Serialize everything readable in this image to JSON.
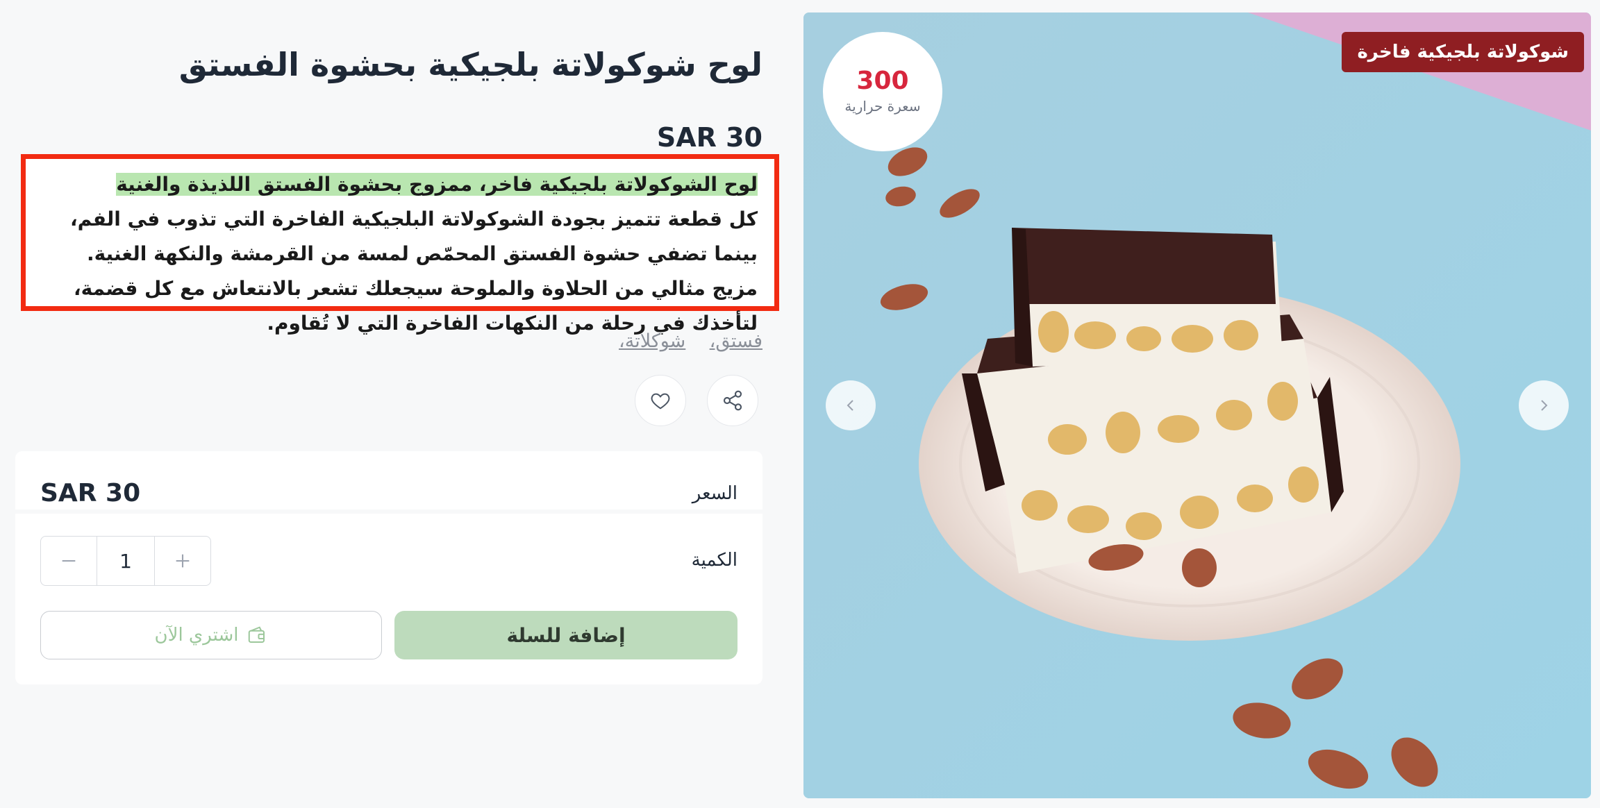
{
  "product": {
    "title": "لوح شوكولاتة بلجيكية بحشوة الفستق",
    "price": "SAR 30",
    "description_highlight": "لوح الشوكولاتة بلجيكية فاخر، ممزوج بحشوة الفستق اللذيذة والغنية",
    "description_body": "كل قطعة تتميز بجودة الشوكولاتة البلجيكية الفاخرة التي تذوب في الفم، بينما تضفي حشوة الفستق المحمّص لمسة من القرمشة والنكهة الغنية. مزيج مثالي من الحلاوة والملوحة سيجعلك تشعر بالانتعاش مع كل قضمة، لتأخذك في رحلة من النكهات الفاخرة التي لا تُقاوم.",
    "tags": [
      "فستق،",
      "شوكلاتة،"
    ]
  },
  "actions": {
    "share_icon": "share-icon",
    "wishlist_icon": "heart-icon"
  },
  "purchase": {
    "price_label": "السعر",
    "price_value": "SAR 30",
    "quantity_label": "الكمية",
    "quantity_value": "1",
    "add_to_cart": "إضافة للسلة",
    "buy_now": "اشتري الآن"
  },
  "gallery": {
    "badge": "شوكولاتة بلجيكية فاخرة",
    "calories_value": "300",
    "calories_label": "سعرة حرارية"
  },
  "colors": {
    "badge_bg": "#8f1e22",
    "calories_color": "#d7263d",
    "add_to_cart_bg": "#bddbbc",
    "highlight_box": "#f22b12"
  }
}
